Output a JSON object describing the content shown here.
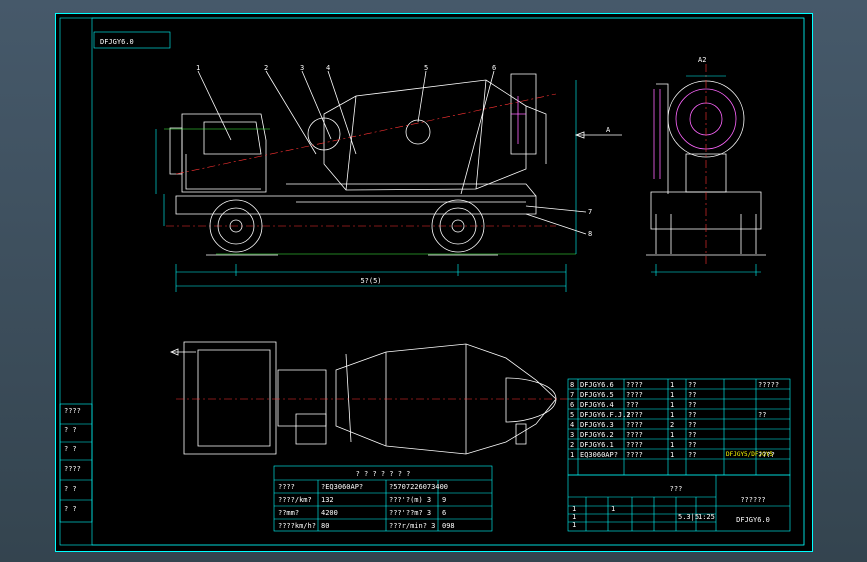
{
  "drawing": {
    "stamp": "DFJGY6.0",
    "balloons": [
      "1",
      "2",
      "3",
      "4",
      "5",
      "6",
      "7",
      "8"
    ],
    "view_label": "A2",
    "arrow_label": "A",
    "overall_length_dim": "5?(5)"
  },
  "left_block": [
    "????",
    "? ?",
    "? ?",
    "????",
    "? ?",
    "? ?"
  ],
  "spec_table": {
    "title": "? ? ? ? ? ? ?",
    "rows": [
      [
        "????",
        "?EQ3060AP?",
        "?5707226073400",
        ""
      ],
      [
        "????/km?",
        "132",
        "???'?(m) 3",
        "9"
      ],
      [
        "??mm?",
        "4200",
        "???'??m? 3",
        "6"
      ],
      [
        "????km/h?",
        "80",
        "???r/min? 3",
        "098"
      ]
    ]
  },
  "bom": {
    "rows": [
      [
        "8",
        "DFJGY6.6",
        "????",
        "1",
        "??",
        "?????"
      ],
      [
        "7",
        "DFJGY6.5",
        "????",
        "1",
        "??",
        ""
      ],
      [
        "6",
        "DFJGY6.4",
        "???",
        "1",
        "??",
        ""
      ],
      [
        "5",
        "DFJGY6.F.J.2",
        "????",
        "1",
        "??",
        "??"
      ],
      [
        "4",
        "DFJGY6.3",
        "????",
        "2",
        "??",
        ""
      ],
      [
        "3",
        "DFJGY6.2",
        "????",
        "1",
        "??",
        ""
      ],
      [
        "2",
        "DFJGY6.1",
        "????",
        "1",
        "??",
        ""
      ],
      [
        "1",
        "EQ3060AP?",
        "????",
        "1",
        "??",
        "????"
      ]
    ],
    "header_code": "DFJGY5/DFJGY5"
  },
  "title_block": {
    "name": "???",
    "unit": "??????",
    "drawing_no": "DFJGY6.0",
    "scale_a": "5.3|5",
    "scale_b": "1:25",
    "sheet_nums": [
      "1",
      "1",
      "1",
      "1"
    ]
  }
}
